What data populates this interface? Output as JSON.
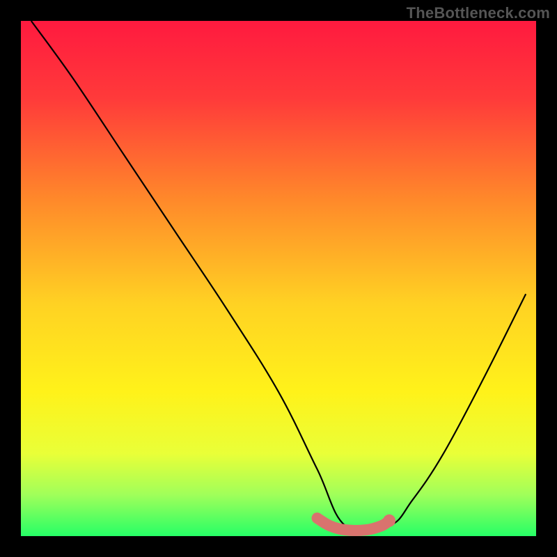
{
  "watermark": "TheBottleneck.com",
  "chart_data": {
    "type": "line",
    "title": "",
    "xlabel": "",
    "ylabel": "",
    "xlim": [
      0,
      1
    ],
    "ylim": [
      0,
      1
    ],
    "background_gradient_stops": [
      {
        "pos": 0.0,
        "color": "#ff1a3f"
      },
      {
        "pos": 0.15,
        "color": "#ff3a3a"
      },
      {
        "pos": 0.35,
        "color": "#ff8a2a"
      },
      {
        "pos": 0.55,
        "color": "#ffd223"
      },
      {
        "pos": 0.72,
        "color": "#fff21a"
      },
      {
        "pos": 0.84,
        "color": "#e9ff38"
      },
      {
        "pos": 0.92,
        "color": "#a0ff5a"
      },
      {
        "pos": 1.0,
        "color": "#26ff66"
      }
    ],
    "series": [
      {
        "name": "bottleneck-curve",
        "color": "#000000",
        "x": [
          0.02,
          0.1,
          0.2,
          0.3,
          0.4,
          0.5,
          0.575,
          0.63,
          0.715,
          0.76,
          0.82,
          0.9,
          0.98
        ],
        "y": [
          1.0,
          0.89,
          0.74,
          0.59,
          0.44,
          0.28,
          0.13,
          0.02,
          0.02,
          0.07,
          0.16,
          0.31,
          0.47
        ]
      },
      {
        "name": "optimal-band",
        "color": "#d9736e",
        "x": [
          0.575,
          0.6,
          0.63,
          0.67,
          0.7,
          0.715
        ],
        "y": [
          0.035,
          0.02,
          0.012,
          0.012,
          0.02,
          0.03
        ]
      }
    ],
    "annotations": []
  }
}
